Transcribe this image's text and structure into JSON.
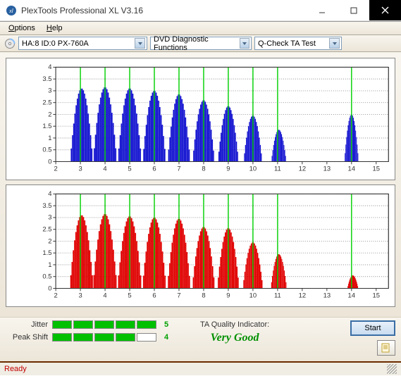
{
  "window": {
    "title": "PlexTools Professional XL V3.16"
  },
  "menu": {
    "options": "Options",
    "help": "Help"
  },
  "toolbar": {
    "drive": "HA:8 ID:0   PX-760A",
    "function": "DVD Diagnostic Functions",
    "test": "Q-Check TA Test"
  },
  "chart_data": [
    {
      "type": "bar",
      "color": "#1414d0",
      "xlim": [
        2,
        15.5
      ],
      "ylim": [
        0,
        4
      ],
      "xticks": [
        2,
        3,
        4,
        5,
        6,
        7,
        8,
        9,
        10,
        11,
        12,
        13,
        14,
        15
      ],
      "yticks": [
        0,
        0.5,
        1,
        1.5,
        2,
        2.5,
        3,
        3.5,
        4
      ],
      "markers": [
        3,
        4,
        5,
        6,
        7,
        8,
        9,
        10,
        11,
        14
      ],
      "peaks": [
        {
          "c": 3.05,
          "h": 3.1,
          "w": 0.88
        },
        {
          "c": 4.0,
          "h": 3.15,
          "w": 0.92
        },
        {
          "c": 5.0,
          "h": 3.1,
          "w": 0.92
        },
        {
          "c": 6.0,
          "h": 3.0,
          "w": 0.9
        },
        {
          "c": 7.0,
          "h": 2.85,
          "w": 0.88
        },
        {
          "c": 8.0,
          "h": 2.6,
          "w": 0.85
        },
        {
          "c": 9.0,
          "h": 2.35,
          "w": 0.8
        },
        {
          "c": 10.0,
          "h": 1.95,
          "w": 0.72
        },
        {
          "c": 11.05,
          "h": 1.35,
          "w": 0.58
        },
        {
          "c": 14.0,
          "h": 2.0,
          "w": 0.55
        }
      ]
    },
    {
      "type": "bar",
      "color": "#e00000",
      "xlim": [
        2,
        15.5
      ],
      "ylim": [
        0,
        4
      ],
      "xticks": [
        2,
        3,
        4,
        5,
        6,
        7,
        8,
        9,
        10,
        11,
        12,
        13,
        14,
        15
      ],
      "yticks": [
        0,
        0.5,
        1,
        1.5,
        2,
        2.5,
        3,
        3.5,
        4
      ],
      "markers": [
        3,
        4,
        5,
        6,
        7,
        8,
        9,
        10,
        11,
        14
      ],
      "peaks": [
        {
          "c": 3.05,
          "h": 3.1,
          "w": 0.92
        },
        {
          "c": 4.0,
          "h": 3.15,
          "w": 0.94
        },
        {
          "c": 5.0,
          "h": 3.05,
          "w": 0.94
        },
        {
          "c": 6.0,
          "h": 3.0,
          "w": 0.92
        },
        {
          "c": 7.0,
          "h": 2.95,
          "w": 0.9
        },
        {
          "c": 8.0,
          "h": 2.6,
          "w": 0.88
        },
        {
          "c": 9.0,
          "h": 2.55,
          "w": 0.85
        },
        {
          "c": 10.0,
          "h": 1.95,
          "w": 0.78
        },
        {
          "c": 11.05,
          "h": 1.45,
          "w": 0.62
        },
        {
          "c": 14.05,
          "h": 0.55,
          "w": 0.42
        }
      ]
    }
  ],
  "meters": {
    "jitter_label": "Jitter",
    "jitter_value": "5",
    "jitter_segments": 5,
    "peakshift_label": "Peak Shift",
    "peakshift_value": "4",
    "peakshift_segments": 4
  },
  "quality": {
    "label": "TA Quality Indicator:",
    "value": "Very Good"
  },
  "actions": {
    "start": "Start"
  },
  "status": {
    "text": "Ready"
  }
}
